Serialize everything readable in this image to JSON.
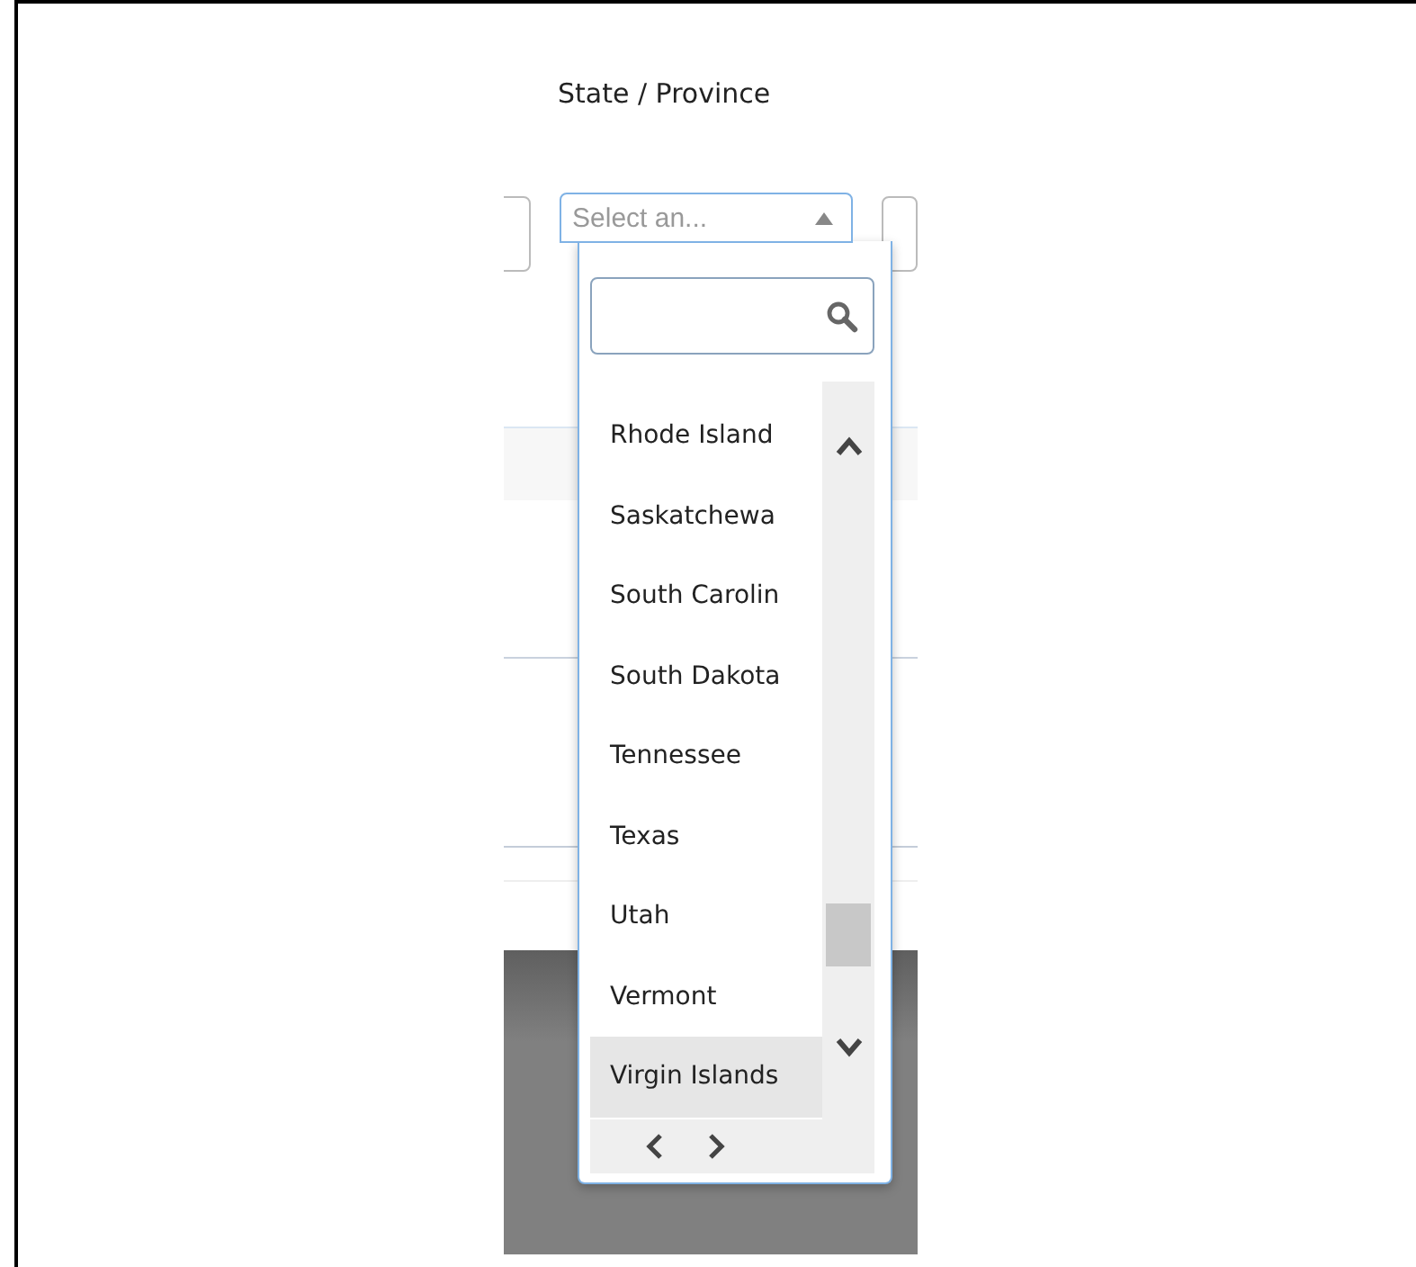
{
  "field": {
    "label": "State / Province",
    "placeholder": "Select an...",
    "expanded": true
  },
  "options": [
    {
      "label": "Rhode Island",
      "selected": false
    },
    {
      "label": "Saskatchewa",
      "selected": false
    },
    {
      "label": "South Carolin",
      "selected": false
    },
    {
      "label": "South Dakota",
      "selected": false
    },
    {
      "label": "Tennessee",
      "selected": false
    },
    {
      "label": "Texas",
      "selected": false
    },
    {
      "label": "Utah",
      "selected": false
    },
    {
      "label": "Vermont",
      "selected": false
    },
    {
      "label": "Virgin Islands",
      "selected": true
    }
  ]
}
